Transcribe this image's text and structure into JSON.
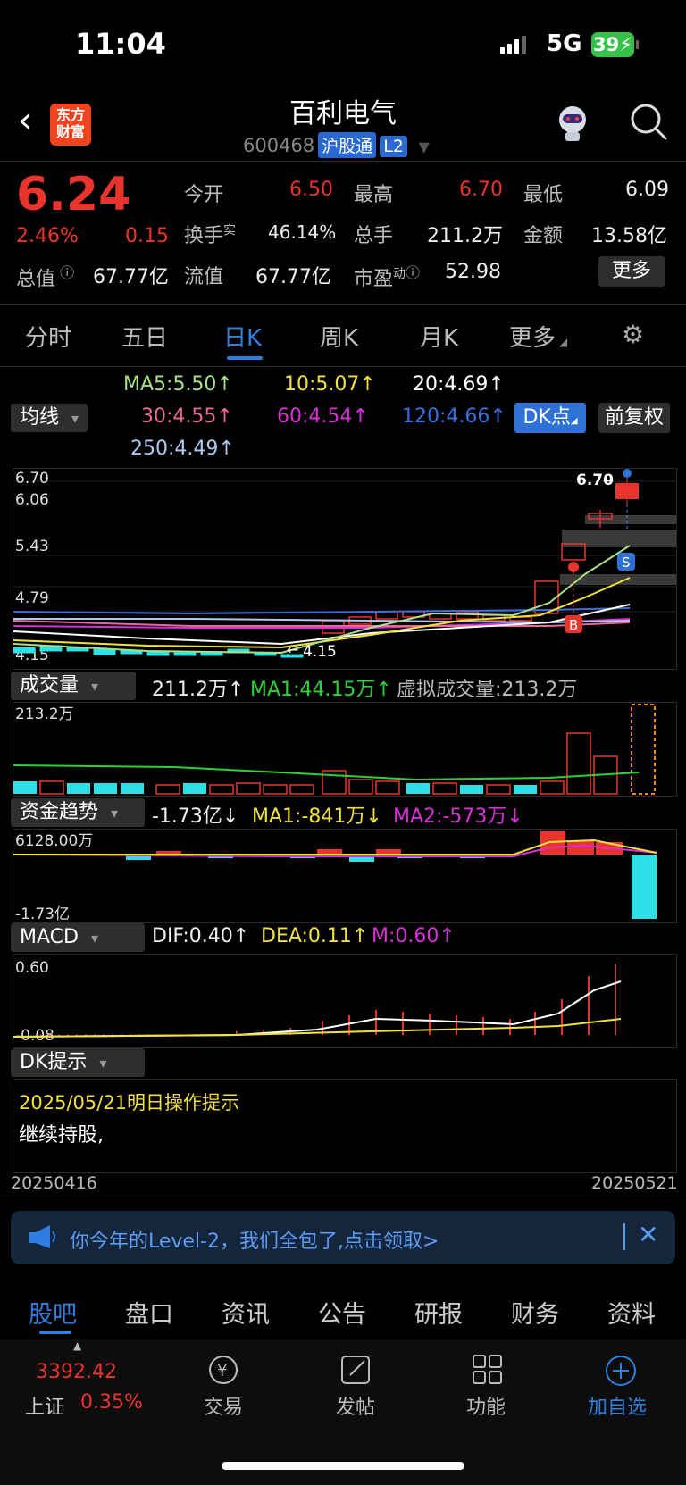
{
  "status": {
    "time": "11:04",
    "network": "5G",
    "battery": "39"
  },
  "header": {
    "logo": "东方财富",
    "title": "百利电气",
    "code": "600468",
    "tag1": "沪股通",
    "tag2": "L2"
  },
  "quote": {
    "price": "6.24",
    "pct": "2.46%",
    "change": "0.15",
    "open_label": "今开",
    "open": "6.50",
    "high_label": "最高",
    "high": "6.70",
    "low_label": "最低",
    "low": "6.09",
    "turnover_label": "换手",
    "turnover_sup": "实",
    "turnover": "46.14%",
    "hands_label": "总手",
    "hands": "211.2万",
    "amount_label": "金额",
    "amount": "13.58亿",
    "mcap_label": "总值",
    "mcap": "67.77亿",
    "float_label": "流值",
    "float": "67.77亿",
    "pe_label": "市盈",
    "pe_sup": "动",
    "pe": "52.98",
    "more": "更多"
  },
  "tabs": [
    "分时",
    "五日",
    "日K",
    "周K",
    "月K",
    "更多"
  ],
  "ma": {
    "select": "均线",
    "ma5": "MA5:5.50↑",
    "ma10": "10:5.07↑",
    "ma20": "20:4.69↑",
    "ma30": "30:4.55↑",
    "ma60": "60:4.54↑",
    "ma120": "120:4.66↑",
    "ma250": "250:4.49↑",
    "dk": "DK点",
    "fq": "前复权"
  },
  "kline": {
    "axis_top": "6.70",
    "axis_2": "6.06",
    "axis_3": "5.43",
    "axis_4": "4.79",
    "axis_bottom": "4.15",
    "max_label": "6.70",
    "min_label": "4.15",
    "s_label": "S",
    "b_label": "B"
  },
  "volume": {
    "select": "成交量",
    "val": "211.2万↑",
    "ma1": "MA1:44.15万↑",
    "virtual": "虚拟成交量:213.2万",
    "axis_top": "213.2万"
  },
  "capital": {
    "select": "资金趋势",
    "val": "-1.73亿↓",
    "ma1": "MA1:-841万↓",
    "ma2": "MA2:-573万↓",
    "axis_top": "6128.00万",
    "axis_bottom": "-1.73亿"
  },
  "macd": {
    "select": "MACD",
    "dif": "DIF:0.40↑",
    "dea": "DEA:0.11↑",
    "m": "M:0.60↑",
    "axis_top": "0.60",
    "axis_bottom": "-0.08"
  },
  "dk": {
    "select": "DK提示",
    "date_line": "2025/05/21明日操作提示",
    "advice": "继续持股,"
  },
  "dates": {
    "start": "20250416",
    "end": "20250521"
  },
  "notice": {
    "text": "你今年的Level-2，我们全包了,点击领取>"
  },
  "bottom_tabs": [
    "股吧",
    "盘口",
    "资讯",
    "公告",
    "研报",
    "财务",
    "资料"
  ],
  "footer": {
    "index_value": "3392.42",
    "index_name": "上证",
    "index_pct": "0.35%",
    "trade": "交易",
    "post": "发帖",
    "func": "功能",
    "add": "加自选"
  }
}
